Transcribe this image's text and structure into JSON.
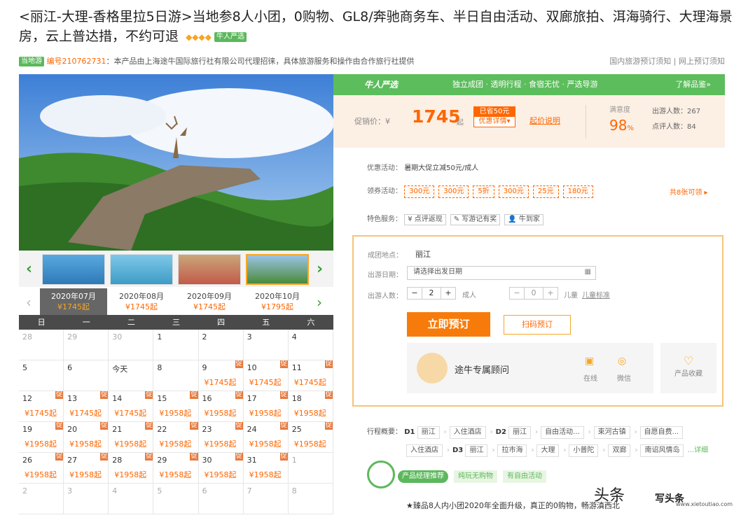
{
  "title": "<丽江-大理-香格里拉5日游>当地参8人小团，0购物、GL8/奔驰商务车、半日自由活动、双廊旅拍、洱海骑行、大理海景房，云上普达措，不约可退",
  "title_badge": "牛人严选",
  "diamonds": "◆◆◆◆",
  "meta": {
    "badge": "当地游",
    "code": "编号210762731",
    "text": "：本产品由上海途牛国际旅行社有限公司代理招徕，具体旅游服务和操作由合作旅行社提供",
    "links": "国内旅游预订须知 | 网上预订须知"
  },
  "months": [
    {
      "label": "2020年07月",
      "price": "¥1745起"
    },
    {
      "label": "2020年08月",
      "price": "¥1745起"
    },
    {
      "label": "2020年09月",
      "price": "¥1745起"
    },
    {
      "label": "2020年10月",
      "price": "¥1795起"
    }
  ],
  "weekdays": [
    "日",
    "一",
    "二",
    "三",
    "四",
    "五",
    "六"
  ],
  "calendar": [
    [
      {
        "d": "28",
        "g": true
      },
      {
        "d": "29",
        "g": true
      },
      {
        "d": "30",
        "g": true
      },
      {
        "d": "1"
      },
      {
        "d": "2"
      },
      {
        "d": "3"
      },
      {
        "d": "4"
      }
    ],
    [
      {
        "d": "5"
      },
      {
        "d": "6"
      },
      {
        "d": "今天"
      },
      {
        "d": "8"
      },
      {
        "d": "9",
        "t": "促",
        "p": "¥1745起"
      },
      {
        "d": "10",
        "t": "促",
        "p": "¥1745起"
      },
      {
        "d": "11",
        "t": "促",
        "p": "¥1745起"
      }
    ],
    [
      {
        "d": "12",
        "t": "促",
        "p": "¥1745起"
      },
      {
        "d": "13",
        "t": "促",
        "p": "¥1745起"
      },
      {
        "d": "14",
        "t": "促",
        "p": "¥1745起"
      },
      {
        "d": "15",
        "t": "促",
        "p": "¥1958起"
      },
      {
        "d": "16",
        "t": "促",
        "p": "¥1958起"
      },
      {
        "d": "17",
        "t": "促",
        "p": "¥1958起"
      },
      {
        "d": "18",
        "t": "促",
        "p": "¥1958起"
      }
    ],
    [
      {
        "d": "19",
        "t": "促",
        "p": "¥1958起"
      },
      {
        "d": "20",
        "t": "促",
        "p": "¥1958起"
      },
      {
        "d": "21",
        "t": "促",
        "p": "¥1958起"
      },
      {
        "d": "22",
        "t": "促",
        "p": "¥1958起"
      },
      {
        "d": "23",
        "t": "促",
        "p": "¥1958起"
      },
      {
        "d": "24",
        "t": "促",
        "p": "¥1958起"
      },
      {
        "d": "25",
        "t": "促",
        "p": "¥1958起"
      }
    ],
    [
      {
        "d": "26",
        "t": "促",
        "p": "¥1958起"
      },
      {
        "d": "27",
        "t": "促",
        "p": "¥1958起"
      },
      {
        "d": "28",
        "t": "促",
        "p": "¥1958起"
      },
      {
        "d": "29",
        "t": "促",
        "p": "¥1958起"
      },
      {
        "d": "30",
        "t": "促",
        "p": "¥1958起"
      },
      {
        "d": "31",
        "t": "促",
        "p": "¥1958起"
      },
      {
        "d": "1",
        "g": true
      }
    ],
    [
      {
        "d": "2",
        "g": true
      },
      {
        "d": "3",
        "g": true
      },
      {
        "d": "4",
        "g": true
      },
      {
        "d": "5",
        "g": true
      },
      {
        "d": "6",
        "g": true
      },
      {
        "d": "7",
        "g": true
      },
      {
        "d": "8",
        "g": true
      }
    ]
  ],
  "gbar": {
    "logo": "牛人严选",
    "slogan": "独立成团 · 透明行程 · 食宿无忧 · 严选导游",
    "more": "了解品鉴»"
  },
  "price": {
    "label": "促销价：¥",
    "value": "1745",
    "qi": "起",
    "save1": "已省50元",
    "save2": "优惠详情▾",
    "explain": "起价说明",
    "sat_label": "满意度",
    "sat_value": "98",
    "sat_unit": "%",
    "travelers": "出游人数：267",
    "reviews": "点评人数：84"
  },
  "promo": {
    "label": "优惠活动：",
    "text": "暑期大促立减50元/成人"
  },
  "coupons": {
    "label": "领券活动：",
    "items": [
      "300元",
      "300元",
      "5折",
      "300元",
      "25元",
      "180元"
    ],
    "more": "共8张可领 ▸"
  },
  "services": {
    "label": "特色服务：",
    "items": [
      "¥ 点评返现",
      "✎ 写游记有奖",
      "👤 牛到家"
    ]
  },
  "booking": {
    "origin_label": "成团地点：",
    "origin": "丽江",
    "date_label": "出游日期：",
    "date_placeholder": "请选择出发日期",
    "people_label": "出游人数：",
    "adults": "2",
    "adult_text": "成人",
    "children": "0",
    "child_text": "儿童",
    "child_std": "儿童标准",
    "book": "立即预订",
    "scan": "扫码预订",
    "advisor": "途牛专属顾问",
    "online": "在线",
    "wechat": "微信",
    "collect": "产品收藏"
  },
  "itinerary": {
    "label": "行程概要：",
    "row1": [
      "D1",
      "丽江",
      "入住酒店",
      "D2",
      "丽江",
      "自由活动...",
      "束河古镇",
      "自愿自费..."
    ],
    "row2": [
      "入住酒店",
      "D3",
      "丽江",
      "拉市海",
      "大理",
      "小普陀",
      "双廊",
      "南诏风情岛"
    ],
    "detail": "...详细"
  },
  "tags": [
    "产品经理推荐",
    "纯玩无购物",
    "有自由活动"
  ],
  "quote": "★臻品8人内小团2020年全面升级，真正的0购物，畅游滇西北",
  "watermark": {
    "t1": "头条",
    "t2": "写头条",
    "url": "www.xietoutiao.com"
  }
}
